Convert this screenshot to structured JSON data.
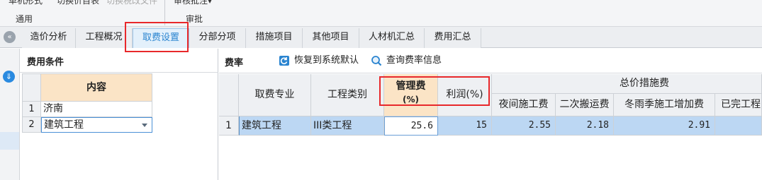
{
  "ribbon": {
    "cut_items": [
      "单机形式",
      "切换价目表",
      "切换税改文件",
      "审核批注▾"
    ],
    "group_labels": [
      "通用",
      "审批"
    ]
  },
  "tabs": [
    "造价分析",
    "工程概况",
    "取费设置",
    "分部分项",
    "措施项目",
    "其他项目",
    "人材机汇总",
    "费用汇总"
  ],
  "active_tab": "取费设置",
  "left_panel": {
    "title": "费用条件",
    "column_header": "内容",
    "rows": [
      {
        "num": "1",
        "value": "济南"
      },
      {
        "num": "2",
        "value": "建筑工程"
      }
    ]
  },
  "right_panel": {
    "title": "费率",
    "restore_button": "恢复到系统默认",
    "query_button": "查询费率信息",
    "headers": {
      "specialty": "取费专业",
      "category": "工程类别",
      "mgmt_fee_line1": "管理费",
      "mgmt_fee_line2": "(%)",
      "profit": "利润(%)",
      "group_total": "总价措施费",
      "night": "夜间施工费",
      "secondary": "二次搬运费",
      "winter": "冬雨季施工增加费",
      "completed": "已完工程"
    },
    "rows": [
      {
        "num": "1",
        "specialty": "建筑工程",
        "category": "III类工程",
        "mgmt_fee": "25.6",
        "profit": "15",
        "night": "2.55",
        "secondary": "2.18",
        "winter": "2.91",
        "completed": ""
      }
    ]
  },
  "colors": {
    "highlight_red": "#e8282b",
    "header_orange": "#fbe4c6",
    "selected_row_blue": "#bcd7f3",
    "active_tab_blue": "#2a84d0"
  }
}
